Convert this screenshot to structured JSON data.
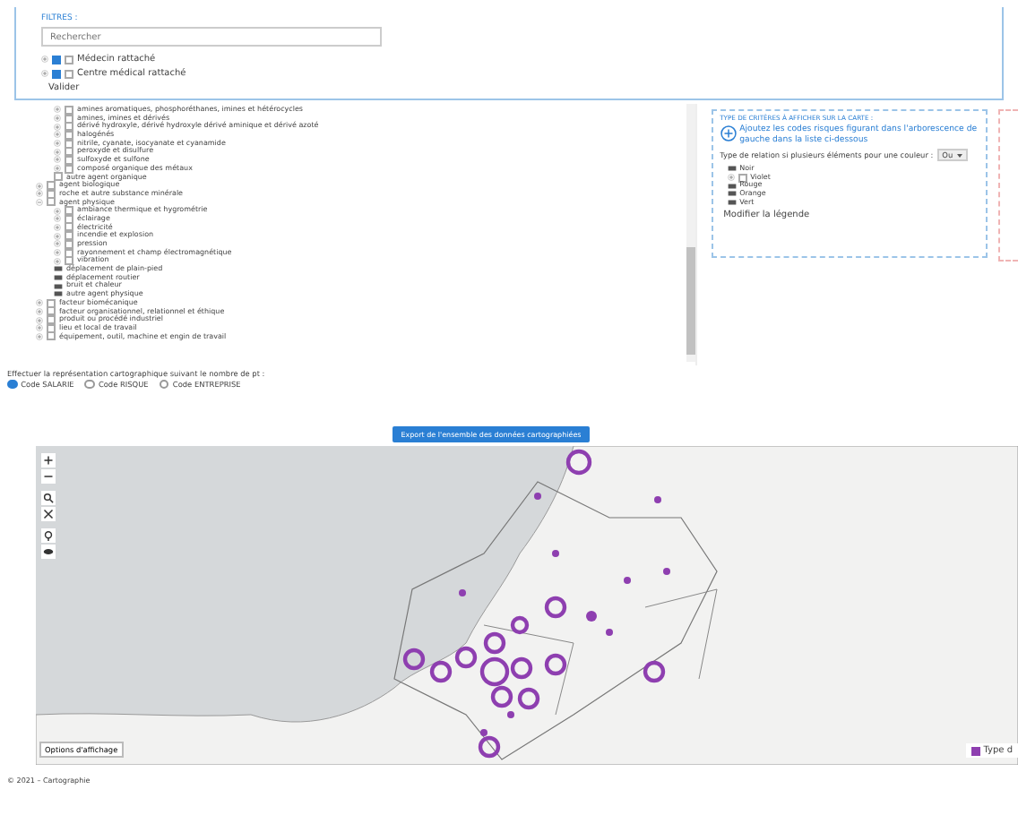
{
  "filters": {
    "title": "FILTRES :",
    "search": {
      "placeholder": "Rechercher"
    },
    "items": [
      {
        "label": "Médecin rattaché",
        "checked": true,
        "inner_checked": false
      },
      {
        "label": "Centre médical rattaché",
        "checked": true,
        "inner_checked": false
      }
    ],
    "submit": "Valider"
  },
  "tree": {
    "partial_children": [
      {
        "label": "amines aromatiques, phosphoréthanes, imines et hétérocycles",
        "kind": "branch",
        "expanded": false,
        "checked": false
      },
      {
        "label": "amines, imines et dérivés",
        "kind": "branch",
        "expanded": false,
        "checked": false
      },
      {
        "label": "dérivé hydroxyle, dérivé hydroxyle dérivé aminique et dérivé azoté",
        "kind": "branch",
        "expanded": false,
        "checked": false
      },
      {
        "label": "halogénés",
        "kind": "branch",
        "expanded": false,
        "checked": false
      },
      {
        "label": "nitrile, cyanate, isocyanate et cyanamide",
        "kind": "branch",
        "expanded": false,
        "checked": false
      },
      {
        "label": "peroxyde et disulfure",
        "kind": "branch",
        "expanded": false,
        "checked": false
      },
      {
        "label": "sulfoxyde et sulfone",
        "kind": "branch",
        "expanded": false,
        "checked": false
      },
      {
        "label": "composé organique des métaux",
        "kind": "branch",
        "expanded": false,
        "checked": false
      },
      {
        "label": "autre agent organique",
        "kind": "leafbox",
        "checked": false
      }
    ],
    "items": [
      {
        "label": "agent biologique",
        "kind": "branch",
        "expanded": false,
        "checked": false
      },
      {
        "label": "roche et autre substance minérale",
        "kind": "branch",
        "expanded": false,
        "checked": false
      },
      {
        "label": "agent physique",
        "kind": "branch",
        "expanded": true,
        "checked": false,
        "children": [
          {
            "label": "ambiance thermique et hygrométrie",
            "kind": "branch",
            "expanded": false,
            "checked": false
          },
          {
            "label": "éclairage",
            "kind": "branch",
            "expanded": false,
            "checked": false
          },
          {
            "label": "électricité",
            "kind": "branch",
            "expanded": false,
            "checked": false
          },
          {
            "label": "incendie et explosion",
            "kind": "branch",
            "expanded": false,
            "checked": false
          },
          {
            "label": "pression",
            "kind": "branch",
            "expanded": false,
            "checked": false
          },
          {
            "label": "rayonnement et champ électromagnétique",
            "kind": "branch",
            "expanded": false,
            "checked": false
          },
          {
            "label": "vibration",
            "kind": "branch",
            "expanded": false,
            "checked": false
          },
          {
            "label": "déplacement de plain-pied",
            "kind": "leaf"
          },
          {
            "label": "déplacement routier",
            "kind": "leaf"
          },
          {
            "label": "bruit et chaleur",
            "kind": "leaf"
          },
          {
            "label": "autre agent physique",
            "kind": "leaf"
          }
        ]
      },
      {
        "label": "facteur biomécanique",
        "kind": "branch",
        "expanded": false,
        "checked": false
      },
      {
        "label": "facteur organisationnel, relationnel et éthique",
        "kind": "branch",
        "expanded": false,
        "checked": false
      },
      {
        "label": "produit ou procédé industriel",
        "kind": "branch",
        "expanded": false,
        "checked": false
      },
      {
        "label": "lieu et local de travail",
        "kind": "branch",
        "expanded": false,
        "checked": false
      },
      {
        "label": "équipement, outil, machine et engin de travail",
        "kind": "branch",
        "expanded": false,
        "checked": false
      }
    ]
  },
  "colors": {
    "title": "TYPE DE CRITÈRES À AFFICHER SUR LA CARTE :",
    "add_link": "Ajoutez les codes risques figurant dans l'arborescence de gauche dans la liste ci-dessous",
    "relation_label": "Type de relation si plusieurs éléments pour une couleur :",
    "relation_value": "Ou",
    "items": [
      {
        "label": "Noir",
        "kind": "leaf"
      },
      {
        "label": "Violet",
        "kind": "branch",
        "expanded": false,
        "checked": false
      },
      {
        "label": "Rouge",
        "kind": "leaf"
      },
      {
        "label": "Orange",
        "kind": "leaf"
      },
      {
        "label": "Vert",
        "kind": "leaf"
      }
    ],
    "edit_link": "Modifier la légende"
  },
  "representation": {
    "label": "Effectuer la représentation cartographique suivant le nombre de pt :",
    "options": [
      {
        "label": "Code SALARIE",
        "selected": true
      },
      {
        "label": "Code RISQUE",
        "selected": false
      },
      {
        "label": "Code ENTREPRISE",
        "selected": false
      }
    ]
  },
  "export_button": "Export de l'ensemble des données cartographiées",
  "map": {
    "display_options": "Options d'affichage",
    "legend": "Type d"
  },
  "footer": "© 2021 – Cartographie"
}
